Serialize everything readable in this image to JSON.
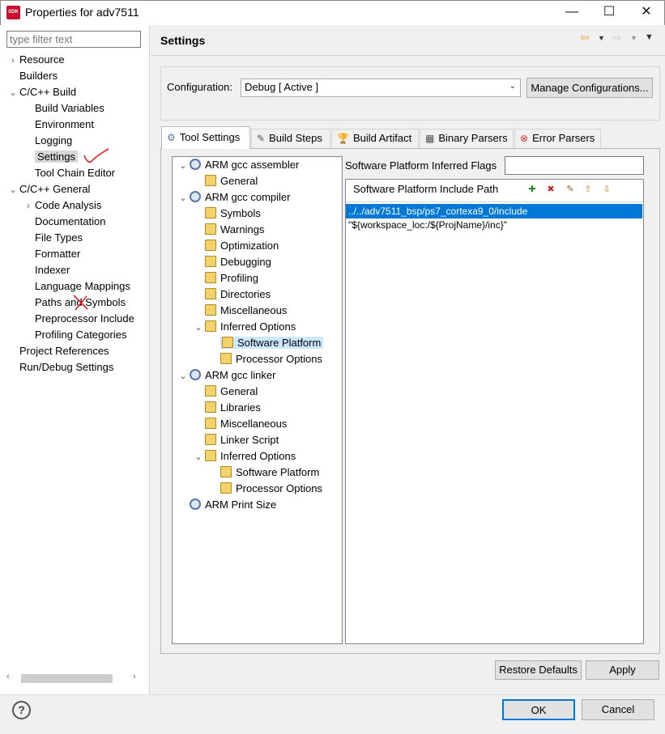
{
  "window": {
    "title": "Properties for adv7511",
    "logo": "SDK",
    "controls": {
      "minimize": "—",
      "maximize": "☐",
      "close": "✕"
    }
  },
  "filter": {
    "placeholder": "type filter text"
  },
  "nav": [
    {
      "label": "Resource",
      "level": 0,
      "arrow": "›",
      "selected": false
    },
    {
      "label": "Builders",
      "level": 0,
      "arrow": "",
      "selected": false
    },
    {
      "label": "C/C++ Build",
      "level": 0,
      "arrow": "⌄",
      "selected": false
    },
    {
      "label": "Build Variables",
      "level": 1,
      "arrow": "",
      "selected": false
    },
    {
      "label": "Environment",
      "level": 1,
      "arrow": "",
      "selected": false
    },
    {
      "label": "Logging",
      "level": 1,
      "arrow": "",
      "selected": false
    },
    {
      "label": "Settings",
      "level": 1,
      "arrow": "",
      "selected": true
    },
    {
      "label": "Tool Chain Editor",
      "level": 1,
      "arrow": "",
      "selected": false
    },
    {
      "label": "C/C++ General",
      "level": 0,
      "arrow": "⌄",
      "selected": false
    },
    {
      "label": "Code Analysis",
      "level": 1,
      "arrow": "›",
      "selected": false
    },
    {
      "label": "Documentation",
      "level": 1,
      "arrow": "",
      "selected": false
    },
    {
      "label": "File Types",
      "level": 1,
      "arrow": "",
      "selected": false
    },
    {
      "label": "Formatter",
      "level": 1,
      "arrow": "",
      "selected": false
    },
    {
      "label": "Indexer",
      "level": 1,
      "arrow": "",
      "selected": false
    },
    {
      "label": "Language Mappings",
      "level": 1,
      "arrow": "",
      "selected": false
    },
    {
      "label": "Paths and Symbols",
      "level": 1,
      "arrow": "",
      "selected": false
    },
    {
      "label": "Preprocessor Include",
      "level": 1,
      "arrow": "",
      "selected": false
    },
    {
      "label": "Profiling Categories",
      "level": 1,
      "arrow": "",
      "selected": false
    },
    {
      "label": "Project References",
      "level": 0,
      "arrow": "",
      "selected": false
    },
    {
      "label": "Run/Debug Settings",
      "level": 0,
      "arrow": "",
      "selected": false
    }
  ],
  "page": {
    "title": "Settings"
  },
  "config": {
    "label": "Configuration:",
    "value": "Debug  [ Active ]",
    "manage_label": "Manage Configurations..."
  },
  "tabs": [
    {
      "label": "Tool Settings",
      "icon": "tool-settings-icon",
      "active": true
    },
    {
      "label": "Build Steps",
      "icon": "build-steps-icon",
      "active": false
    },
    {
      "label": "Build Artifact",
      "icon": "build-artifact-icon",
      "active": false
    },
    {
      "label": "Binary Parsers",
      "icon": "binary-parsers-icon",
      "active": false
    },
    {
      "label": "Error Parsers",
      "icon": "error-parsers-icon",
      "active": false
    }
  ],
  "tree": [
    {
      "label": "ARM gcc assembler",
      "level": 0,
      "arrow": "⌄",
      "icon": "gear",
      "selected": false
    },
    {
      "label": "General",
      "level": 1,
      "arrow": "",
      "icon": "folder",
      "selected": false
    },
    {
      "label": "ARM gcc compiler",
      "level": 0,
      "arrow": "⌄",
      "icon": "gear",
      "selected": false
    },
    {
      "label": "Symbols",
      "level": 1,
      "arrow": "",
      "icon": "folder",
      "selected": false
    },
    {
      "label": "Warnings",
      "level": 1,
      "arrow": "",
      "icon": "folder",
      "selected": false
    },
    {
      "label": "Optimization",
      "level": 1,
      "arrow": "",
      "icon": "folder",
      "selected": false
    },
    {
      "label": "Debugging",
      "level": 1,
      "arrow": "",
      "icon": "folder",
      "selected": false
    },
    {
      "label": "Profiling",
      "level": 1,
      "arrow": "",
      "icon": "folder",
      "selected": false
    },
    {
      "label": "Directories",
      "level": 1,
      "arrow": "",
      "icon": "folder",
      "selected": false
    },
    {
      "label": "Miscellaneous",
      "level": 1,
      "arrow": "",
      "icon": "folder",
      "selected": false
    },
    {
      "label": "Inferred Options",
      "level": 1,
      "arrow": "⌄",
      "icon": "folder",
      "selected": false
    },
    {
      "label": "Software Platform",
      "level": 2,
      "arrow": "",
      "icon": "folder",
      "selected": true
    },
    {
      "label": "Processor Options",
      "level": 2,
      "arrow": "",
      "icon": "folder",
      "selected": false
    },
    {
      "label": "ARM gcc linker",
      "level": 0,
      "arrow": "⌄",
      "icon": "gear",
      "selected": false
    },
    {
      "label": "General",
      "level": 1,
      "arrow": "",
      "icon": "folder",
      "selected": false
    },
    {
      "label": "Libraries",
      "level": 1,
      "arrow": "",
      "icon": "folder",
      "selected": false
    },
    {
      "label": "Miscellaneous",
      "level": 1,
      "arrow": "",
      "icon": "folder",
      "selected": false
    },
    {
      "label": "Linker Script",
      "level": 1,
      "arrow": "",
      "icon": "folder",
      "selected": false
    },
    {
      "label": "Inferred Options",
      "level": 1,
      "arrow": "⌄",
      "icon": "folder",
      "selected": false
    },
    {
      "label": "Software Platform",
      "level": 2,
      "arrow": "",
      "icon": "folder",
      "selected": false
    },
    {
      "label": "Processor Options",
      "level": 2,
      "arrow": "",
      "icon": "folder",
      "selected": false
    },
    {
      "label": "ARM Print Size",
      "level": 0,
      "arrow": "",
      "icon": "gear",
      "selected": false
    }
  ],
  "flags": {
    "label": "Software Platform Inferred Flags",
    "value": ""
  },
  "include": {
    "label": "Software Platform Include Path",
    "tools": [
      "add-icon",
      "delete-icon",
      "edit-icon",
      "move-up-icon",
      "move-down-icon"
    ],
    "paths": [
      {
        "value": "../../adv7511_bsp/ps7_cortexa9_0/include",
        "selected": true
      },
      {
        "value": "\"${workspace_loc:/${ProjName}/inc}\"",
        "selected": false
      }
    ]
  },
  "buttons": {
    "restore": "Restore Defaults",
    "apply": "Apply",
    "ok": "OK",
    "cancel": "Cancel",
    "help": "?"
  },
  "colors": {
    "selection": "#0078d7",
    "tree_selection": "#cce8ff",
    "annotation_red": "#e0202a"
  }
}
